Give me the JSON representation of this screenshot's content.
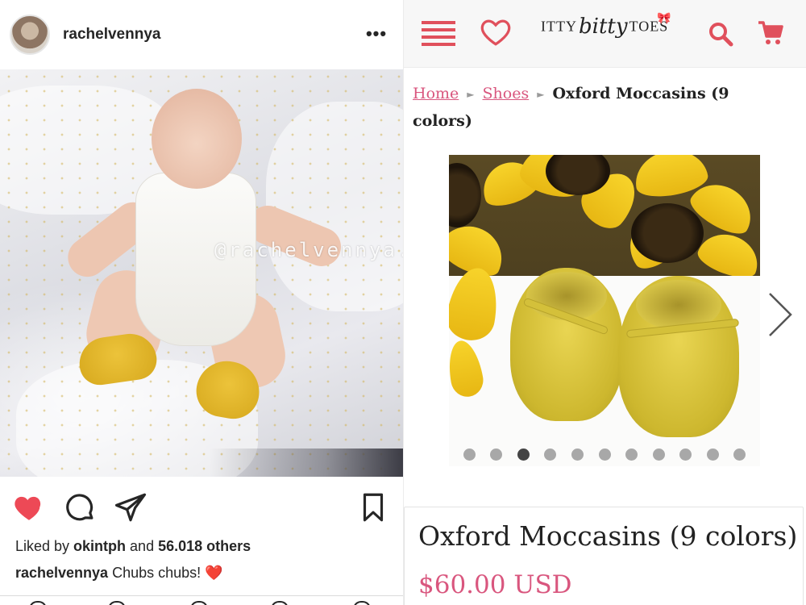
{
  "instagram": {
    "username": "rachelvennya",
    "more_icon": "more-dots-icon",
    "more_glyph": "•••",
    "watermark": "@rachelvennya.fashion",
    "likes": {
      "prefix": "Liked by ",
      "user": "okintph",
      "connector": " and ",
      "count": "56.018 others"
    },
    "caption": {
      "user": "rachelvennya",
      "text": " Chubs chubs! ",
      "emoji": "❤️"
    },
    "icons": {
      "like": "heart-filled-icon",
      "comment": "comment-bubble-icon",
      "share": "send-paper-plane-icon",
      "save": "bookmark-icon"
    },
    "like_color": "#ed4956"
  },
  "shop": {
    "logo": {
      "part1": "ITTY",
      "part2": "bitty",
      "part3": "TOES",
      "bow": "🎀"
    },
    "nav_icons": [
      "menu-icon",
      "heart-outline-icon",
      "search-icon",
      "cart-icon"
    ],
    "accent_color": "#e0505c",
    "breadcrumb": {
      "home": "Home",
      "shoes": "Shoes",
      "separator": "►",
      "current": "Oxford Moccasins (9 colors)"
    },
    "carousel": {
      "dot_count": 11,
      "active_index": 2
    },
    "product": {
      "title": "Oxford Moccasins (9 colors)",
      "price": "$60.00 USD",
      "price_color": "#d9567e"
    }
  }
}
